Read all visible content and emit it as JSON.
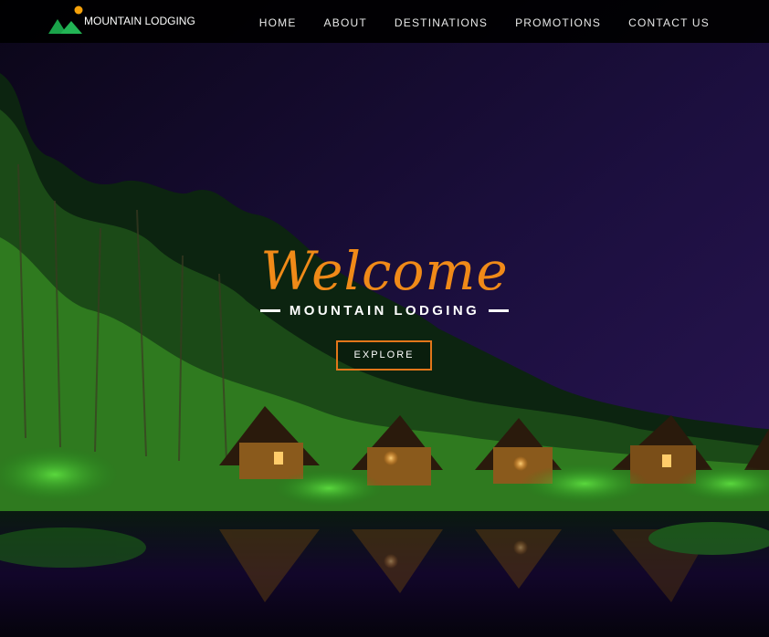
{
  "brand": {
    "name": "MOUNTAIN LODGING"
  },
  "nav": {
    "items": [
      {
        "label": "HOME"
      },
      {
        "label": "ABOUT"
      },
      {
        "label": "DESTINATIONS"
      },
      {
        "label": "PROMOTIONS"
      },
      {
        "label": "CONTACT US"
      }
    ]
  },
  "hero": {
    "title": "Welcome",
    "subtitle": "MOUNTAIN LODGING",
    "button_label": "EXPLORE"
  },
  "colors": {
    "accent": "#f08a18",
    "button_border": "#e2761a",
    "logo_green": "#1aa34a",
    "logo_sun": "#f5a10a",
    "sky": "#1a0f3a"
  }
}
